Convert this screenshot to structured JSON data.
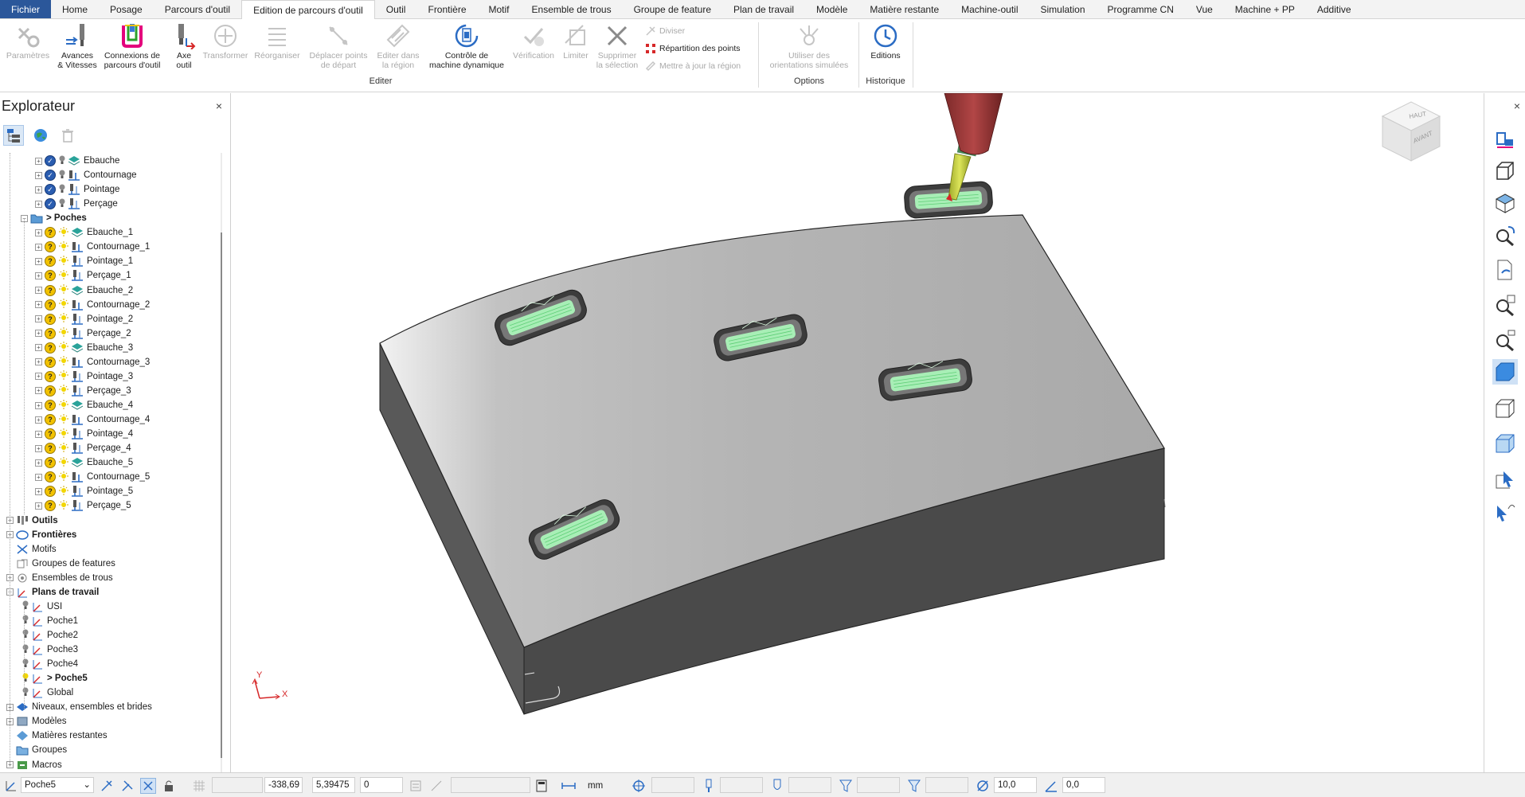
{
  "menu": {
    "file": "Fichier",
    "items": [
      "Home",
      "Posage",
      "Parcours d'outil",
      "Edition de parcours d'outil",
      "Outil",
      "Frontière",
      "Motif",
      "Ensemble de trous",
      "Groupe de feature",
      "Plan de travail",
      "Modèle",
      "Matière restante",
      "Machine-outil",
      "Simulation",
      "Programme CN",
      "Vue",
      "Machine + PP",
      "Additive"
    ],
    "active_index": 3
  },
  "ribbon": {
    "parametres": "Paramètres",
    "avances_l1": "Avances",
    "avances_l2": "& Vitesses",
    "connexions_l1": "Connexions de",
    "connexions_l2": "parcours d'outil",
    "axe_l1": "Axe",
    "axe_l2": "outil",
    "transformer": "Transformer",
    "reorganiser": "Réorganiser",
    "deplacer_l1": "Déplacer points",
    "deplacer_l2": "de départ",
    "editer_l1": "Editer dans",
    "editer_l2": "la région",
    "controle_l1": "Contrôle de",
    "controle_l2": "machine dynamique",
    "verification": "Vérification",
    "limiter": "Limiter",
    "supprimer_l1": "Supprimer",
    "supprimer_l2": "la sélection",
    "diviser": "Diviser",
    "repartition": "Répartition des points",
    "mettre_a_jour": "Mettre à jour la région",
    "utiliser_l1": "Utiliser des",
    "utiliser_l2": "orientations simulées",
    "editions": "Editions",
    "group_editer": "Editer",
    "group_options": "Options",
    "group_historique": "Historique"
  },
  "explorer": {
    "title": "Explorateur",
    "close": "×",
    "tree": [
      {
        "level": 2,
        "label": "Ebauche",
        "check": "ok",
        "icon": "layers-icon"
      },
      {
        "level": 2,
        "label": "Contournage",
        "check": "ok",
        "icon": "profile-icon"
      },
      {
        "level": 2,
        "label": "Pointage",
        "check": "ok",
        "icon": "drill-icon"
      },
      {
        "level": 2,
        "label": "Perçage",
        "check": "ok",
        "icon": "drill-icon"
      },
      {
        "level": 1,
        "label": "> Poches",
        "bold": true,
        "icon": "folder-icon"
      },
      {
        "level": 2,
        "label": "Ebauche_1",
        "check": "q",
        "icon": "layers-icon"
      },
      {
        "level": 2,
        "label": "Contournage_1",
        "check": "q",
        "icon": "profile-icon"
      },
      {
        "level": 2,
        "label": "Pointage_1",
        "check": "q",
        "icon": "drill-icon"
      },
      {
        "level": 2,
        "label": "Perçage_1",
        "check": "q",
        "icon": "drill-icon"
      },
      {
        "level": 2,
        "label": "Ebauche_2",
        "check": "q",
        "icon": "layers-icon"
      },
      {
        "level": 2,
        "label": "Contournage_2",
        "check": "q",
        "icon": "profile-icon"
      },
      {
        "level": 2,
        "label": "Pointage_2",
        "check": "q",
        "icon": "drill-icon"
      },
      {
        "level": 2,
        "label": "Perçage_2",
        "check": "q",
        "icon": "drill-icon"
      },
      {
        "level": 2,
        "label": "Ebauche_3",
        "check": "q",
        "icon": "layers-icon"
      },
      {
        "level": 2,
        "label": "Contournage_3",
        "check": "q",
        "icon": "profile-icon"
      },
      {
        "level": 2,
        "label": "Pointage_3",
        "check": "q",
        "icon": "drill-icon"
      },
      {
        "level": 2,
        "label": "Perçage_3",
        "check": "q",
        "icon": "drill-icon"
      },
      {
        "level": 2,
        "label": "Ebauche_4",
        "check": "q",
        "icon": "layers-icon"
      },
      {
        "level": 2,
        "label": "Contournage_4",
        "check": "q",
        "icon": "profile-icon"
      },
      {
        "level": 2,
        "label": "Pointage_4",
        "check": "q",
        "icon": "drill-icon"
      },
      {
        "level": 2,
        "label": "Perçage_4",
        "check": "q",
        "icon": "drill-icon"
      },
      {
        "level": 2,
        "label": "Ebauche_5",
        "check": "q",
        "icon": "layers-icon"
      },
      {
        "level": 2,
        "label": "Contournage_5",
        "check": "q",
        "icon": "profile-icon"
      },
      {
        "level": 2,
        "label": "Pointage_5",
        "check": "q",
        "icon": "drill-icon"
      },
      {
        "level": 2,
        "label": "Perçage_5",
        "check": "q",
        "icon": "drill-icon"
      },
      {
        "level": 0,
        "label": "Outils",
        "bold": true,
        "icon": "tools-icon"
      },
      {
        "level": 0,
        "label": "Frontières",
        "bold": true,
        "icon": "boundary-icon"
      },
      {
        "level": 0,
        "label": "Motifs",
        "icon": "pattern-icon"
      },
      {
        "level": 0,
        "label": "Groupes de features",
        "icon": "feature-group-icon"
      },
      {
        "level": 0,
        "label": "Ensembles de trous",
        "icon": "holes-icon"
      },
      {
        "level": 0,
        "label": "Plans de travail",
        "bold": true,
        "icon": "workplane-icon"
      },
      {
        "level": 1,
        "label": "USI",
        "icon": "workplane-icon",
        "bulb": true
      },
      {
        "level": 1,
        "label": "Poche1",
        "icon": "workplane-icon",
        "bulb": true
      },
      {
        "level": 1,
        "label": "Poche2",
        "icon": "workplane-icon",
        "bulb": true
      },
      {
        "level": 1,
        "label": "Poche3",
        "icon": "workplane-icon",
        "bulb": true
      },
      {
        "level": 1,
        "label": "Poche4",
        "icon": "workplane-icon",
        "bulb": true
      },
      {
        "level": 1,
        "label": "> Poche5",
        "bold": true,
        "icon": "workplane-icon",
        "bulb": true,
        "bulb_on": true
      },
      {
        "level": 1,
        "label": "Global",
        "icon": "workplane-icon",
        "bulb": true
      },
      {
        "level": 0,
        "label": "Niveaux, ensembles et brides",
        "icon": "levels-icon"
      },
      {
        "level": 0,
        "label": "Modèles",
        "icon": "models-icon"
      },
      {
        "level": 0,
        "label": "Matières restantes",
        "icon": "stock-icon"
      },
      {
        "level": 0,
        "label": "Groupes",
        "icon": "groups-icon"
      },
      {
        "level": 0,
        "label": "Macros",
        "icon": "macros-icon"
      }
    ]
  },
  "viewport": {
    "cube_top": "HAUT",
    "cube_front": "AVANT",
    "axis_y": "Y",
    "axis_x": "X"
  },
  "statusbar": {
    "workplane": "Poche5",
    "coord_x": "-338,69",
    "coord_y": "5,39475",
    "coord_z": "0",
    "unit": "mm",
    "tolerance": "10,0",
    "angle": "0,0"
  },
  "colors": {
    "accent": "#2b579a",
    "part_top": "#b8b8b8",
    "part_side": "#4a4a4a",
    "toolpath": "#9ff0b0",
    "holder": "#a33a3a",
    "tool": "#c9d43a"
  }
}
